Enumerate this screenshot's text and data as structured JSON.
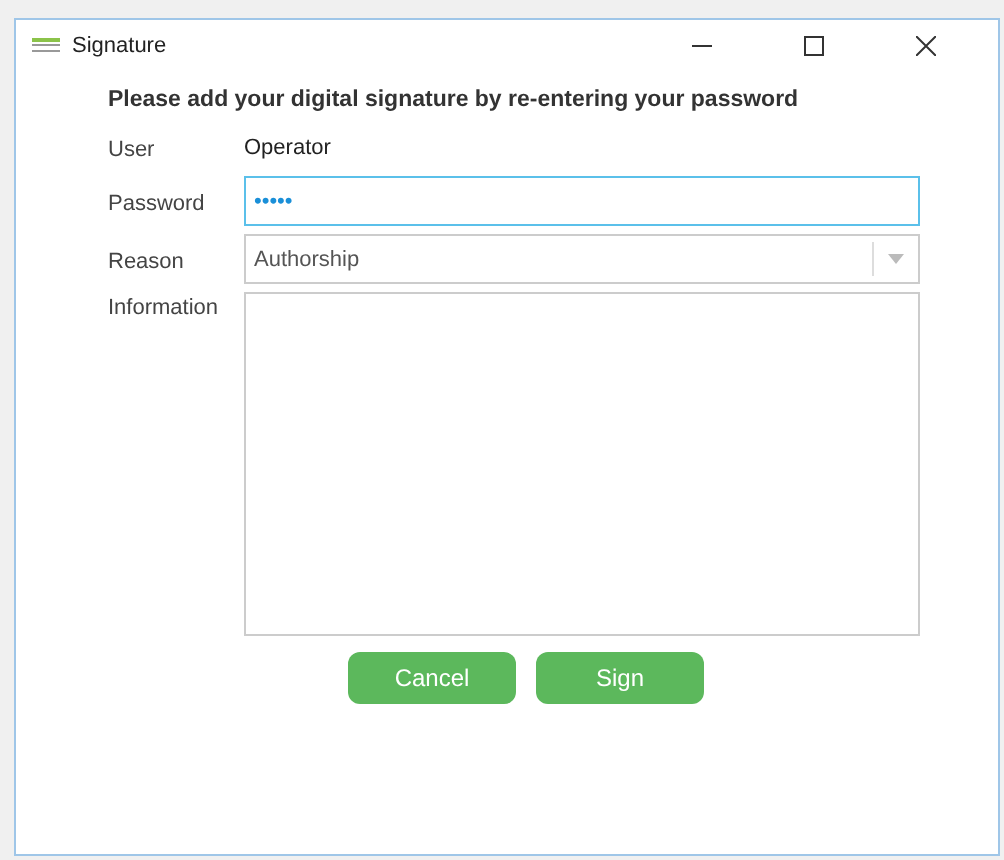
{
  "window": {
    "title": "Signature"
  },
  "heading": "Please add your digital signature by re-entering your password",
  "form": [
    {
      "kind": "text",
      "label": "User",
      "value": "Operator"
    },
    {
      "kind": "input",
      "label": "Password",
      "value": "•••••",
      "focused": true
    },
    {
      "kind": "select",
      "label": "Reason",
      "value": "Authorship"
    },
    {
      "kind": "textarea",
      "label": "Information"
    }
  ],
  "buttons": [
    "Cancel",
    "Sign"
  ]
}
